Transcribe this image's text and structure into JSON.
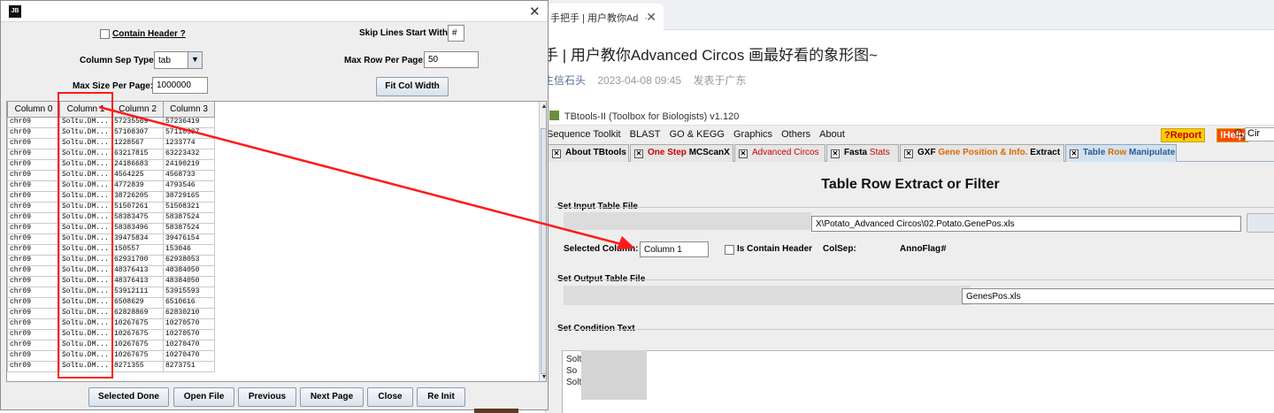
{
  "browser": {
    "tab_title": "手把手 | 用户教你Ad",
    "tab_menu": "···",
    "tab_close": "✕",
    "article_title": "手 | 用户教你Advanced Circos 画最好看的象形图~",
    "author": "生信石头",
    "date": "2023-04-08 09:45",
    "location": "发表于广东"
  },
  "tbtools": {
    "window_title": "TBtools-II (Toolbox for Biologists) v1.120",
    "menu": [
      "Sequence Toolkit",
      "BLAST",
      "GO & KEGG",
      "Graphics",
      "Others",
      "About"
    ],
    "report_badge": "?Report",
    "help_badge": "!Help",
    "search_value": "Cir",
    "tabs": {
      "about": "About TBtools",
      "one_step_a": "One Step ",
      "one_step_b": "MCScanX",
      "advanced_circos": "Advanced Circos",
      "fasta_a": "Fasta ",
      "fasta_b": "Stats",
      "gxf_a": "GXF ",
      "gxf_b": "Gene Position & Info.",
      "gxf_c": " Extract",
      "table_a": "Table ",
      "table_b": "Row",
      "table_c": " Manipulate"
    },
    "panel_title": "Table Row Extract or Filter",
    "set_input_label": "Set Input Table File",
    "input_path": "X\\Potato_Advanced Circos\\02.Potato.GenePos.xls",
    "selected_column_label": "Selected Column:",
    "selected_column_value": "Column 1",
    "contain_header_label": "Is Contain Header",
    "colsep_label": "ColSep:",
    "annoflag_label": "AnnoFlag:",
    "annoflag_value": "#",
    "set_output_label": "Set Output Table File",
    "output_path": "GenesPos.xls",
    "set_condition_label": "Set Condition Text",
    "condition_lines": [
      "Soltu.DM.01G0",
      "So",
      "Soltu"
    ]
  },
  "dialog": {
    "logo": "JB",
    "close": "✕",
    "contain_header_label": "Contain Header ?",
    "skip_lines_label": "Skip Lines Start With:",
    "skip_lines_value": "#",
    "column_sep_label": "Column Sep Type:",
    "column_sep_value": "tab",
    "max_row_label": "Max Row Per Page:",
    "max_row_value": "50",
    "max_size_label": "Max Size Per Page:",
    "max_size_value": "1000000",
    "fit_col_button": "Fit Col Width",
    "columns": [
      "Column 0",
      "Column 1",
      "Column 2",
      "Column 3"
    ],
    "rows": [
      [
        "chr09",
        "Soltu.DM...",
        "57235569",
        "57236419"
      ],
      [
        "chr09",
        "Soltu.DM...",
        "57108307",
        "57110387"
      ],
      [
        "chr09",
        "Soltu.DM...",
        "1228567",
        "1233774"
      ],
      [
        "chr09",
        "Soltu.DM...",
        "63217815",
        "63223432"
      ],
      [
        "chr09",
        "Soltu.DM...",
        "24186683",
        "24190219"
      ],
      [
        "chr09",
        "Soltu.DM...",
        "4564225",
        "4568733"
      ],
      [
        "chr09",
        "Soltu.DM...",
        "4772839",
        "4793546"
      ],
      [
        "chr09",
        "Soltu.DM...",
        "38726205",
        "38729165"
      ],
      [
        "chr09",
        "Soltu.DM...",
        "51507261",
        "51508321"
      ],
      [
        "chr09",
        "Soltu.DM...",
        "58383475",
        "58387524"
      ],
      [
        "chr09",
        "Soltu.DM...",
        "58383496",
        "58387524"
      ],
      [
        "chr09",
        "Soltu.DM...",
        "39475834",
        "39476154"
      ],
      [
        "chr09",
        "Soltu.DM...",
        "150557",
        "153046"
      ],
      [
        "chr09",
        "Soltu.DM...",
        "62931700",
        "62938053"
      ],
      [
        "chr09",
        "Soltu.DM...",
        "48376413",
        "48384050"
      ],
      [
        "chr09",
        "Soltu.DM...",
        "48376413",
        "48384050"
      ],
      [
        "chr09",
        "Soltu.DM...",
        "53912111",
        "53915593"
      ],
      [
        "chr09",
        "Soltu.DM...",
        "6508629",
        "6510616"
      ],
      [
        "chr09",
        "Soltu.DM...",
        "62828869",
        "62830210"
      ],
      [
        "chr09",
        "Soltu.DM...",
        "10267675",
        "10270570"
      ],
      [
        "chr09",
        "Soltu.DM...",
        "10267675",
        "10270570"
      ],
      [
        "chr09",
        "Soltu.DM...",
        "10267675",
        "10270470"
      ],
      [
        "chr09",
        "Soltu.DM...",
        "10267675",
        "10270470"
      ],
      [
        "chr09",
        "Soltu.DM...",
        "8271355",
        "8273751"
      ]
    ],
    "buttons": {
      "selected_done": "Selected Done",
      "open_file": "Open File",
      "previous": "Previous",
      "next_page": "Next Page",
      "close": "Close",
      "re_init": "Re Init"
    }
  },
  "annotation_color": "#ff1a1a"
}
